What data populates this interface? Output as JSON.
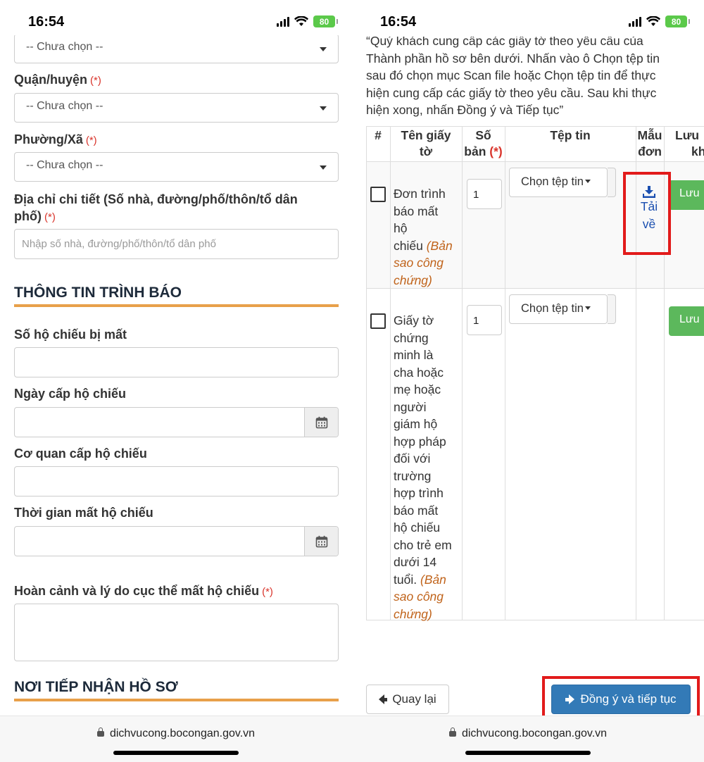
{
  "status_bar": {
    "time": "16:54",
    "battery": "80"
  },
  "browser": {
    "url": "dichvucong.bocongan.gov.vn"
  },
  "form": {
    "top_select": {
      "value": "-- Chưa chọn --"
    },
    "district": {
      "label": "Quận/huyện",
      "required": "(*)",
      "value": "-- Chưa chọn --"
    },
    "ward": {
      "label": "Phường/Xã",
      "required": "(*)",
      "value": "-- Chưa chọn --"
    },
    "address": {
      "label_line1": "Địa chỉ chi tiết (Số nhà, đường/phố/thôn/tổ dân",
      "label_line2": "phố)",
      "required": "(*)",
      "placeholder": "Nhập số nhà, đường/phố/thôn/tổ dân phố"
    },
    "report_section": {
      "title": "THÔNG TIN TRÌNH BÁO"
    },
    "passport_number": {
      "label": "Số hộ chiếu bị mất",
      "value": ""
    },
    "issue_date": {
      "label": "Ngày cấp hộ chiếu",
      "value": ""
    },
    "issuing_agency": {
      "label": "Cơ quan cấp hộ chiếu",
      "value": ""
    },
    "loss_time": {
      "label": "Thời gian mất hộ chiếu",
      "value": ""
    },
    "loss_reason": {
      "label": "Hoàn cảnh và lý do cục thể mất hộ chiếu",
      "required": "(*)",
      "value": ""
    },
    "receiving_section": {
      "title": "NƠI TIẾP NHẬN HỒ SƠ"
    }
  },
  "documents": {
    "instruction_lines": [
      "“Quý khách cung cấp các giấy tờ theo yêu cầu của",
      "Thành phần hồ sơ bên dưới. Nhấn vào ô Chọn tệp tin",
      "sau đó chọn mục Scan file hoặc Chọn tệp tin để thực",
      "hiện cung cấp các giấy tờ theo yêu cầu. Sau khi thực",
      "hiện xong, nhấn Đồng ý và Tiếp tục”"
    ],
    "headers": {
      "index": "#",
      "name_line1": "Tên giấy",
      "name_line2": "tờ",
      "copies_line1": "Số",
      "copies_line2": "bản",
      "copies_required": "(*)",
      "file": "Tệp tin",
      "template_line1": "Mẫu",
      "template_line2": "đơn",
      "save_line1": "Lưu",
      "save_line2": "kh"
    },
    "rows": [
      {
        "name_lines": [
          "Đơn trình",
          "báo mất",
          "hộ",
          "chiếu"
        ],
        "note_lines": [
          "(Bản",
          "sao công",
          "chứng)"
        ],
        "copies": "1",
        "file_button": "Chọn tệp tin",
        "template_line1": "Tải",
        "template_line2": "về",
        "save": "Lưu"
      },
      {
        "name_lines": [
          "Giấy tờ",
          "chứng",
          "minh là",
          "cha hoặc",
          "mẹ hoặc",
          "người",
          "giám hộ",
          "hợp pháp",
          "đối với",
          "trường",
          "hợp trình",
          "báo mất",
          "hộ chiếu",
          "cho trẻ em",
          "dưới 14",
          "tuổi."
        ],
        "note_lines": [
          "(Bản",
          "sao công",
          "chứng)"
        ],
        "copies": "1",
        "file_button": "Chọn tệp tin",
        "save": "Lưu"
      }
    ],
    "back_button": "Quay lại",
    "continue_button": "Đồng ý và tiếp tục"
  },
  "colors": {
    "accent_line": "#e8a04a",
    "primary": "#337ab7",
    "save_green": "#5cb85c",
    "highlight_red": "#e21b1b",
    "note_orange": "#c0631a"
  }
}
